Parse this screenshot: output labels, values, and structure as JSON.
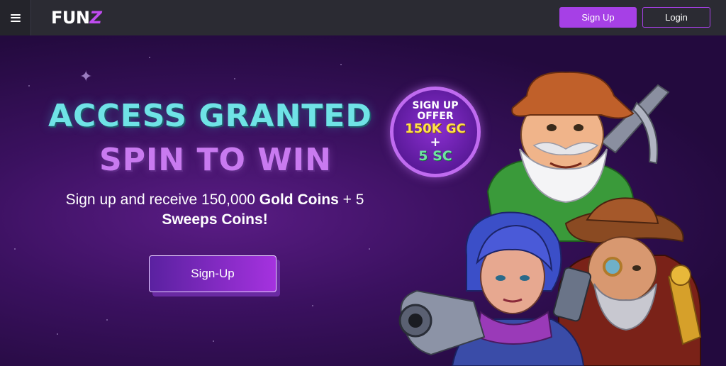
{
  "header": {
    "menu_icon": "hamburger-menu-icon",
    "logo_text": "FUN",
    "logo_accent": "Z",
    "signup_label": "Sign Up",
    "login_label": "Login"
  },
  "hero": {
    "headline_line1": "ACCESS GRANTED",
    "headline_line2": "SPIN TO WIN",
    "subtitle_part1": "Sign up and receive 150,000 ",
    "subtitle_bold1": "Gold Coins",
    "subtitle_part2": " + 5 ",
    "subtitle_bold2": "Sweeps Coins!",
    "cta_label": "Sign-Up",
    "badge": {
      "line1": "SIGN UP",
      "line2": "OFFER",
      "line3": "150K GC",
      "line4": "+",
      "line5": "5 SC"
    },
    "illustration": "slot-characters-illustration"
  },
  "colors": {
    "accent": "#a640e6",
    "header_bg": "#2b2b33",
    "headline_teal": "#6fe3e6",
    "headline_purple": "#c97af0",
    "badge_gold": "#ffe14a",
    "badge_green": "#6fe3a0"
  }
}
